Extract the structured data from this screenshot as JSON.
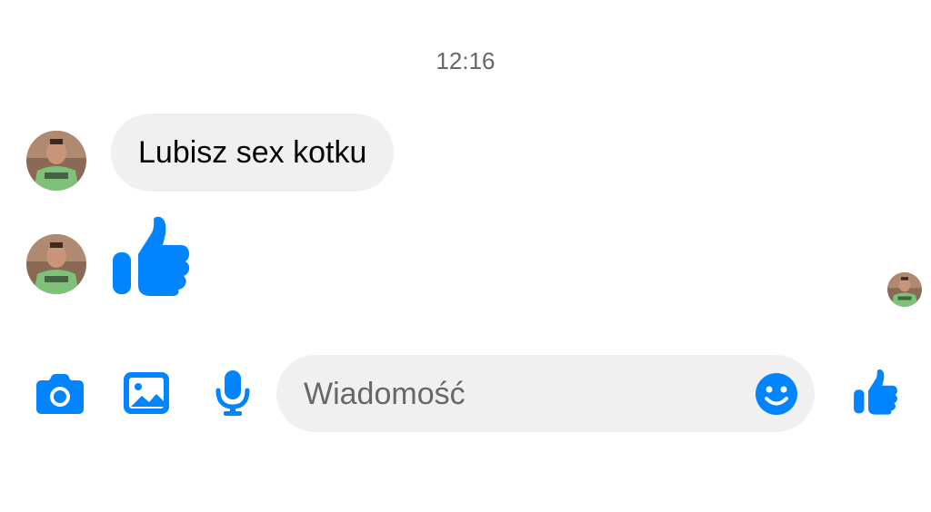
{
  "conversation": {
    "timestamp": "12:16",
    "messages": [
      {
        "type": "text",
        "text": "Lubisz sex kotku"
      },
      {
        "type": "like-sticker",
        "icon": "thumbs-up-icon"
      }
    ]
  },
  "composer": {
    "placeholder": "Wiadomość",
    "icons": [
      "camera-icon",
      "image-icon",
      "microphone-icon",
      "smiley-icon",
      "thumbs-up-icon"
    ]
  },
  "colors": {
    "accent": "#0084ff",
    "bubble_bg": "#f0f0f0",
    "timestamp": "#65676b"
  }
}
